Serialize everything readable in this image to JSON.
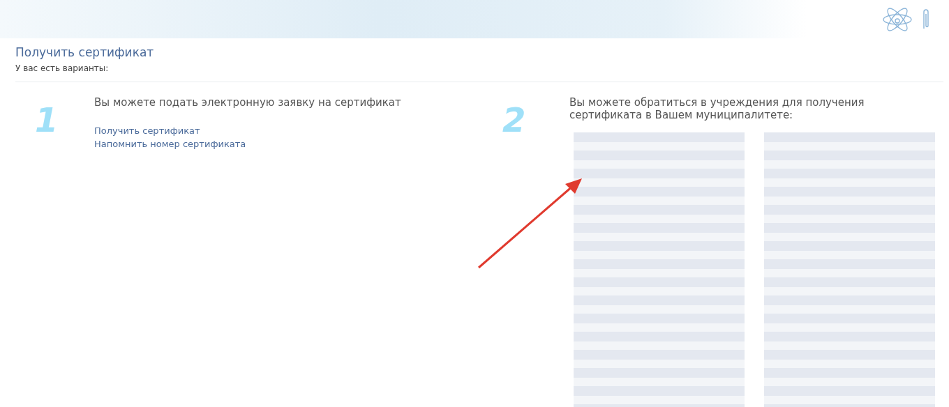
{
  "header": {
    "title": "Получить сертификат",
    "subtitle": "У вас есть варианты:"
  },
  "options": [
    {
      "number": "1",
      "text": "Вы можете подать электронную заявку на сертификат",
      "links": [
        "Получить сертификат",
        "Напомнить номер сертификата"
      ]
    },
    {
      "number": "2",
      "text": "Вы можете обратиться в учреждения для получения сертификата в Вашем муниципалитете:"
    }
  ]
}
